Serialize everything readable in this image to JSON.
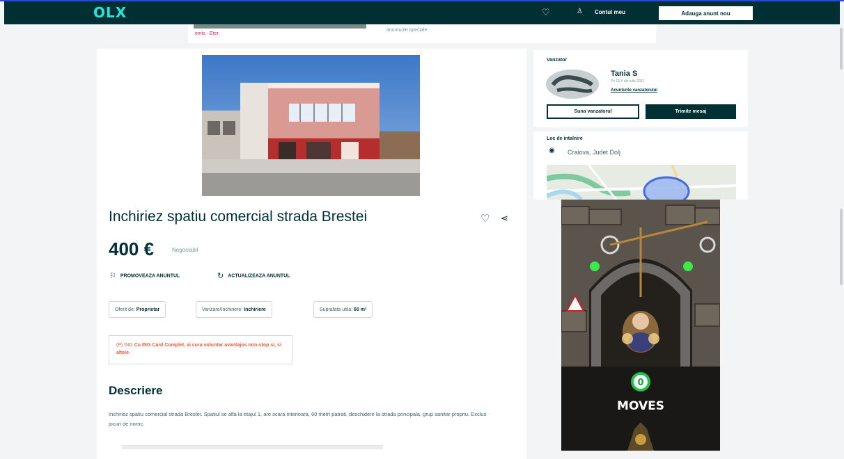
{
  "header": {
    "logo": "OLX",
    "favorites_icon": "heart-icon",
    "account_icon": "user-icon",
    "account_label": "Contul meu",
    "post_button": "Adauga anunt nou"
  },
  "promo_strip": {
    "tags": "emis · Eter",
    "text": "anunturile speciale"
  },
  "listing": {
    "title": "Inchiriez spatiu comercial strada Brestei",
    "price": "400 €",
    "negotiable": "Negociabil",
    "actions": [
      {
        "label": "PROMOVEAZA ANUNTUL",
        "icon": "bookmark-icon"
      },
      {
        "label": "ACTUALIZEAZA ANUNTUL",
        "icon": "refresh-icon"
      }
    ],
    "tags": [
      {
        "key": "Oferit de:",
        "value": "Proprietar"
      },
      {
        "key": "Vanzare/Inchiriere:",
        "value": "Inchiriere"
      },
      {
        "key": "Suprafata utila:",
        "value": "60 m²"
      }
    ],
    "promo_box": {
      "tag": "(P) ING",
      "text": "Cu ING Card Complet, ai cura voluntar avantajos non-stop si, si altele."
    },
    "description_heading": "Descriere",
    "description": "Inchiriez spatiu comercial strada Brestei. Spatiul se afla la etajul 1, are scara interioara, 60 metri patrati, deschidere la strada principala, grup sanitar propriu. Exclus jocuri de noroc."
  },
  "seller": {
    "heading": "Vanzator",
    "name": "Tania S",
    "since": "Pe OLX din iulie 2021",
    "ads_link": "Anunturile vanzatorului",
    "call_button": "Suna vanzatorul",
    "message_button": "Trimite mesaj"
  },
  "location": {
    "heading": "Loc de intalnire",
    "icon": "location-pin-icon",
    "place": "Craiova, Judet Dolj"
  },
  "ad": {
    "moves_count": "0",
    "moves_label": "MOVES"
  },
  "colors": {
    "brand_dark": "#002f34",
    "brand_teal": "#23e5db",
    "promo_orange": "#ff5636"
  }
}
